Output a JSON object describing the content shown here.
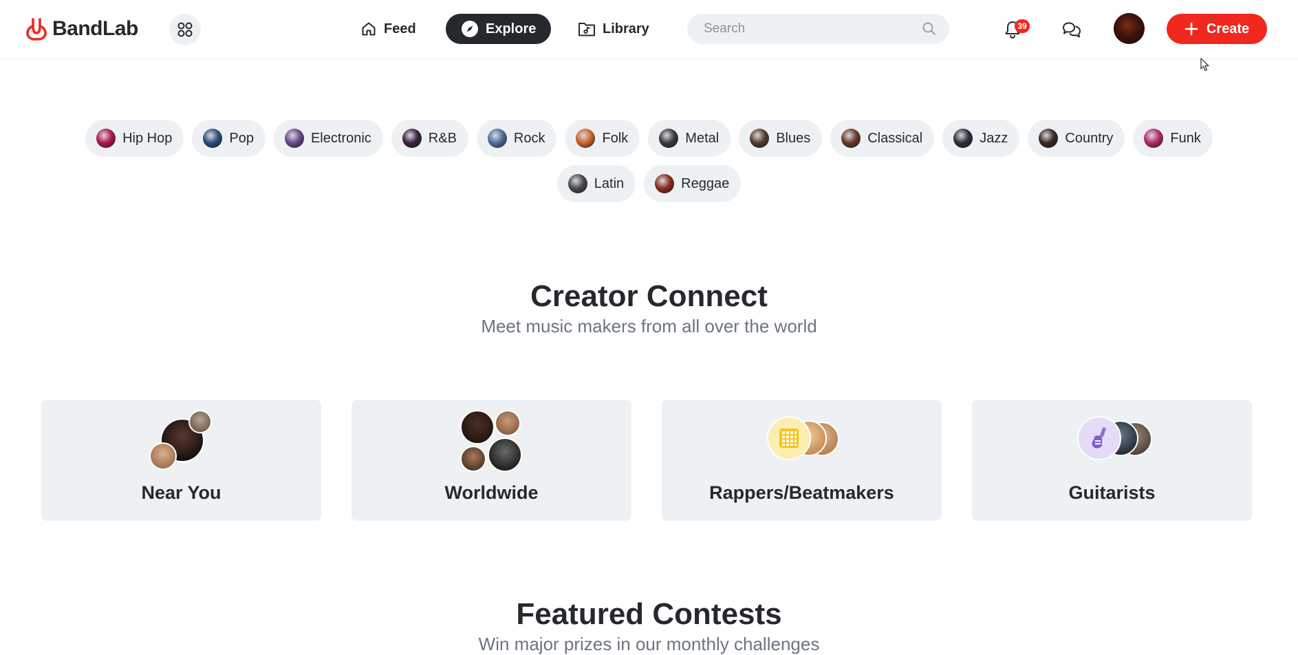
{
  "header": {
    "logo_text": "BandLab",
    "nav": {
      "feed": "Feed",
      "explore": "Explore",
      "library": "Library"
    },
    "search_placeholder": "Search",
    "notification_count": "39",
    "create_label": "Create"
  },
  "genres": [
    {
      "label": "Hip Hop",
      "color": "#b0174a"
    },
    {
      "label": "Pop",
      "color": "#2c4f7a"
    },
    {
      "label": "Electronic",
      "color": "#6b4a8c"
    },
    {
      "label": "R&B",
      "color": "#3b2340"
    },
    {
      "label": "Rock",
      "color": "#4d6fa0"
    },
    {
      "label": "Folk",
      "color": "#d0642a"
    },
    {
      "label": "Metal",
      "color": "#3a3a3e"
    },
    {
      "label": "Blues",
      "color": "#5a3c2c"
    },
    {
      "label": "Classical",
      "color": "#6a3a2a"
    },
    {
      "label": "Jazz",
      "color": "#2e3038"
    },
    {
      "label": "Country",
      "color": "#3b2a22"
    },
    {
      "label": "Funk",
      "color": "#b42a6a"
    },
    {
      "label": "Latin",
      "color": "#4a4a4e"
    },
    {
      "label": "Reggae",
      "color": "#8c2e1e"
    }
  ],
  "creator_connect": {
    "title": "Creator Connect",
    "subtitle": "Meet music makers from all over the world",
    "cards": [
      {
        "label": "Near You"
      },
      {
        "label": "Worldwide"
      },
      {
        "label": "Rappers/Beatmakers"
      },
      {
        "label": "Guitarists"
      }
    ]
  },
  "featured_contests": {
    "title": "Featured Contests",
    "subtitle": "Win major prizes in our monthly challenges"
  },
  "colors": {
    "brand": "#f0281e",
    "dark": "#25282d",
    "surface": "#eef1f4"
  }
}
